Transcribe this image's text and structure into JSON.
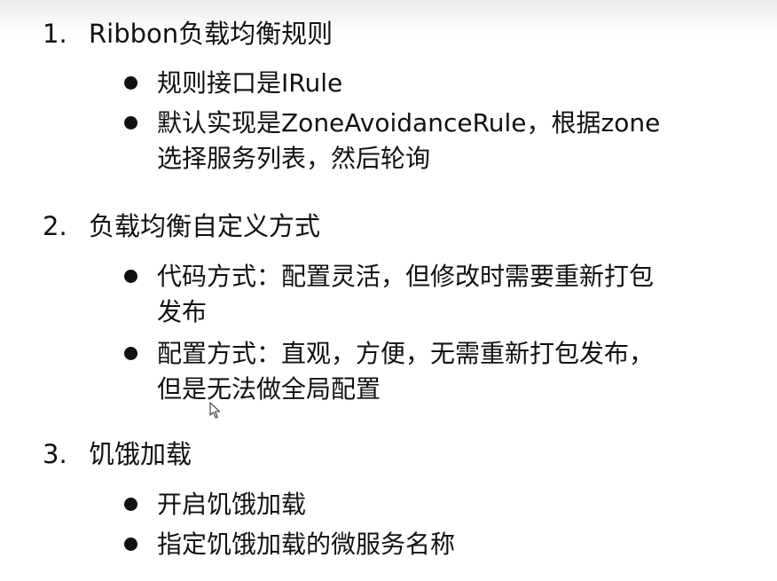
{
  "sections": [
    {
      "number": "1.",
      "title": "Ribbon负载均衡规则",
      "bullets": [
        {
          "lines": [
            "规则接口是IRule"
          ]
        },
        {
          "lines": [
            "默认实现是ZoneAvoidanceRule，根据zone",
            "选择服务列表，然后轮询"
          ]
        }
      ]
    },
    {
      "number": "2.",
      "title": "负载均衡自定义方式",
      "bullets": [
        {
          "lines": [
            "代码方式：配置灵活，但修改时需要重新打包",
            "发布"
          ]
        },
        {
          "lines": [
            "配置方式：直观，方便，无需重新打包发布，",
            "但是无法做全局配置"
          ]
        }
      ]
    },
    {
      "number": "3.",
      "title": "饥饿加载",
      "bullets": [
        {
          "lines": [
            "开启饥饿加载"
          ]
        },
        {
          "lines": [
            "指定饥饿加载的微服务名称"
          ]
        }
      ]
    }
  ]
}
